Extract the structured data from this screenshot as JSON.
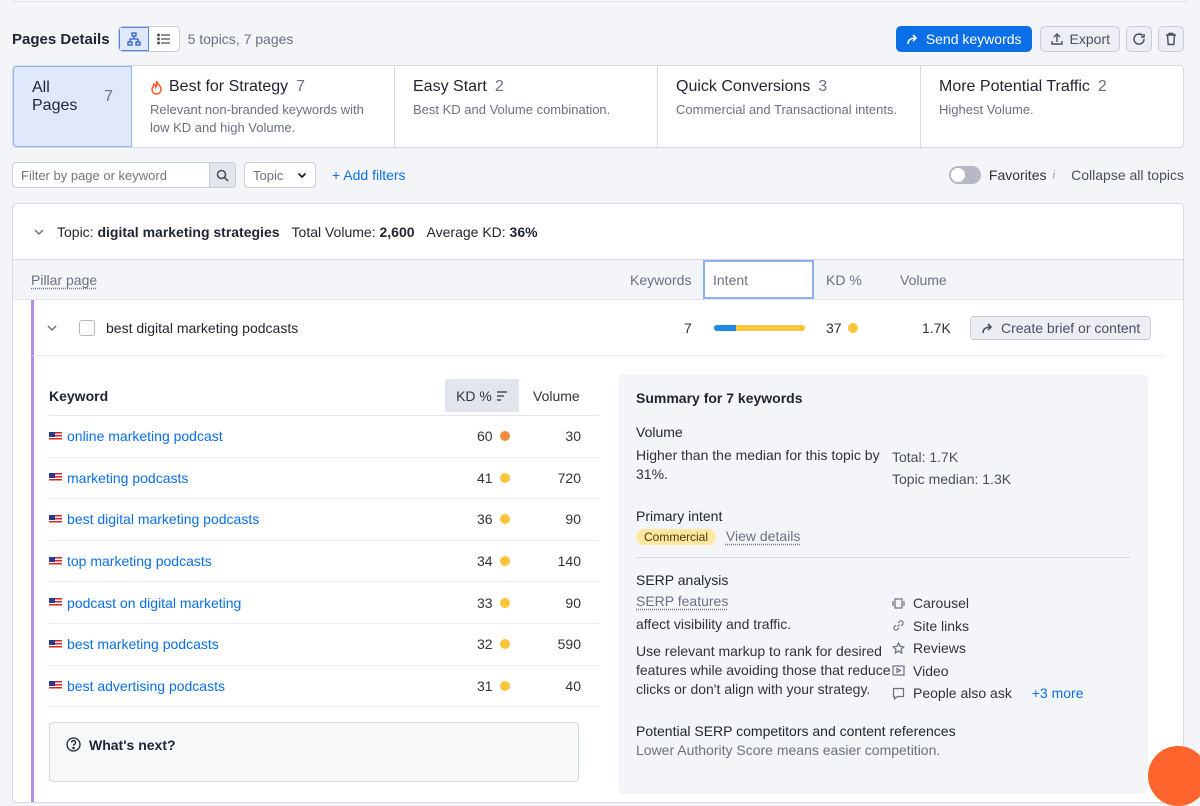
{
  "header": {
    "title": "Pages Details",
    "summary": "5 topics, 7 pages",
    "send_keywords": "Send keywords",
    "export": "Export"
  },
  "categories": [
    {
      "title": "All Pages",
      "count": "7",
      "desc": "",
      "active": true
    },
    {
      "title": "Best for Strategy",
      "count": "7",
      "desc": "Relevant non-branded keywords with low KD and high Volume."
    },
    {
      "title": "Easy Start",
      "count": "2",
      "desc": "Best KD and Volume combination."
    },
    {
      "title": "Quick Conversions",
      "count": "3",
      "desc": "Commercial and Transactional intents."
    },
    {
      "title": "More Potential Traffic",
      "count": "2",
      "desc": "Highest Volume."
    }
  ],
  "filters": {
    "search_placeholder": "Filter by page or keyword",
    "topic_label": "Topic",
    "add_filters": "+ Add filters",
    "favorites": "Favorites",
    "collapse_all": "Collapse all topics"
  },
  "topic": {
    "prefix": "Topic:",
    "name": "digital marketing strategies",
    "total_volume_label": "Total Volume:",
    "total_volume": "2,600",
    "avg_kd_label": "Average KD:",
    "avg_kd": "36%"
  },
  "columns": {
    "pillar": "Pillar page",
    "keywords": "Keywords",
    "intent": "Intent",
    "kd": "KD %",
    "volume": "Volume"
  },
  "page_row": {
    "name": "best digital marketing podcasts",
    "keywords": "7",
    "intent_commercial_fraction": 0.24,
    "kd": "37",
    "volume": "1.7K",
    "brief_button": "Create brief or content"
  },
  "keyword_table": {
    "headers": {
      "keyword": "Keyword",
      "kd": "KD %",
      "volume": "Volume"
    },
    "rows": [
      {
        "keyword": "online marketing podcast",
        "kd": "60",
        "volume": "30",
        "color": "#f58a3b"
      },
      {
        "keyword": "marketing podcasts",
        "kd": "41",
        "volume": "720",
        "color": "#fac43b"
      },
      {
        "keyword": "best digital marketing podcasts",
        "kd": "36",
        "volume": "90",
        "color": "#fac43b"
      },
      {
        "keyword": "top marketing podcasts",
        "kd": "34",
        "volume": "140",
        "color": "#fac43b"
      },
      {
        "keyword": "podcast on digital marketing",
        "kd": "33",
        "volume": "90",
        "color": "#fac43b"
      },
      {
        "keyword": "best marketing podcasts",
        "kd": "32",
        "volume": "590",
        "color": "#fac43b"
      },
      {
        "keyword": "best advertising podcasts",
        "kd": "31",
        "volume": "40",
        "color": "#fac43b"
      }
    ]
  },
  "whats_next": "What's next?",
  "summary_card": {
    "title": "Summary for 7 keywords",
    "volume_label": "Volume",
    "volume_text": "Higher than the median for this topic by 31%.",
    "total": "Total: 1.7K",
    "median": "Topic median: 1.3K",
    "intent_label": "Primary intent",
    "intent_badge": "Commercial",
    "view_details": "View details",
    "serp_label": "SERP analysis",
    "serp_features_link": "SERP features",
    "serp_text1": "affect visibility and traffic.",
    "serp_text2": "Use relevant markup to rank for desired features while avoiding those that reduce clicks or don't align with your strategy.",
    "serp_features": [
      "Carousel",
      "Site links",
      "Reviews",
      "Video",
      "People also ask"
    ],
    "more": "+3 more",
    "competitors_title": "Potential SERP competitors and content references",
    "competitors_sub": "Lower Authority Score means easier competition."
  },
  "colors": {
    "accent": "#0b6fe8",
    "pillar_border": "#b58ee8",
    "kd_orange": "#f58a3b",
    "kd_yellow": "#fac43b"
  }
}
